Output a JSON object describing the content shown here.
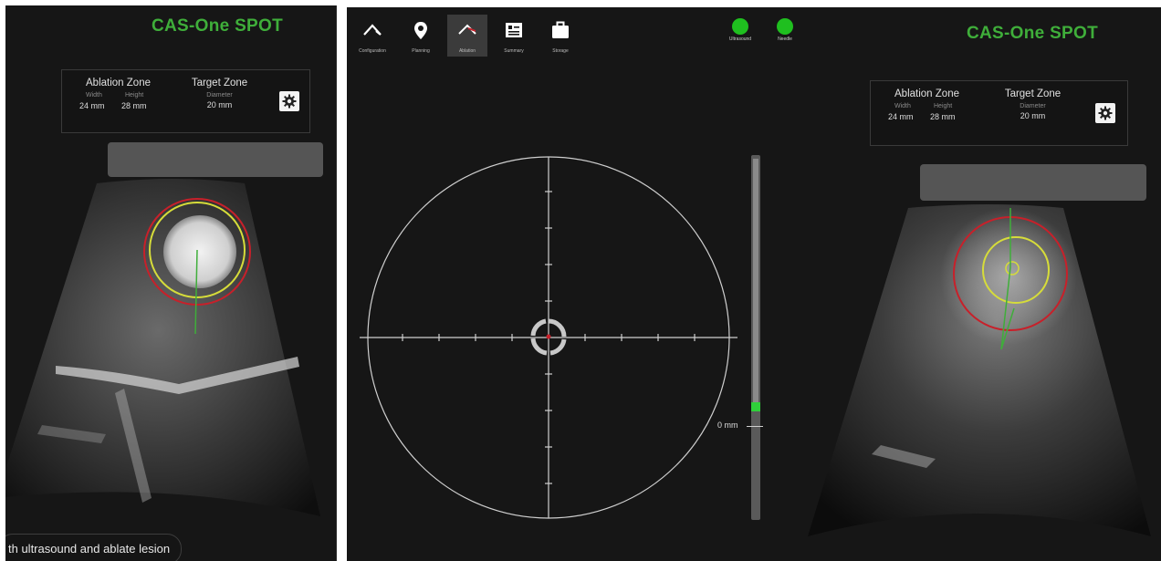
{
  "left_panel": {
    "brand": "CAS-One SPOT",
    "ablation_zone": {
      "title": "Ablation Zone",
      "width_label": "Width",
      "height_label": "Height",
      "width_value": "24 mm",
      "height_value": "28 mm"
    },
    "target_zone": {
      "title": "Target Zone",
      "diameter_label": "Diameter",
      "diameter_value": "20 mm"
    },
    "settings_icon": "gear-icon",
    "hint_text": "th ultrasound and ablate lesion"
  },
  "right_panel": {
    "brand": "CAS-One SPOT",
    "toolbar": [
      {
        "label": "Configuration",
        "icon": "configuration-icon",
        "active": false
      },
      {
        "label": "Planning",
        "icon": "location-pin-icon",
        "active": false
      },
      {
        "label": "Ablation",
        "icon": "ablation-icon",
        "active": true
      },
      {
        "label": "Summary",
        "icon": "summary-icon",
        "active": false
      },
      {
        "label": "Storage",
        "icon": "briefcase-icon",
        "active": false
      }
    ],
    "status": [
      {
        "label": "Ultrasound",
        "color": "#1fbf1f"
      },
      {
        "label": "Needle",
        "color": "#1fbf1f"
      }
    ],
    "ablation_zone": {
      "title": "Ablation Zone",
      "width_label": "Width",
      "height_label": "Height",
      "width_value": "24 mm",
      "height_value": "28 mm"
    },
    "target_zone": {
      "title": "Target Zone",
      "diameter_label": "Diameter",
      "diameter_value": "20 mm"
    },
    "settings_icon": "gear-icon",
    "depth_readout": "0 mm",
    "depth_level": 0.69
  },
  "colors": {
    "brand_green": "#3fae3a",
    "status_green": "#1fbf1f",
    "ablation_ring": "#c8202a",
    "target_ring": "#d6dc3a",
    "panel_bg": "#161616"
  }
}
